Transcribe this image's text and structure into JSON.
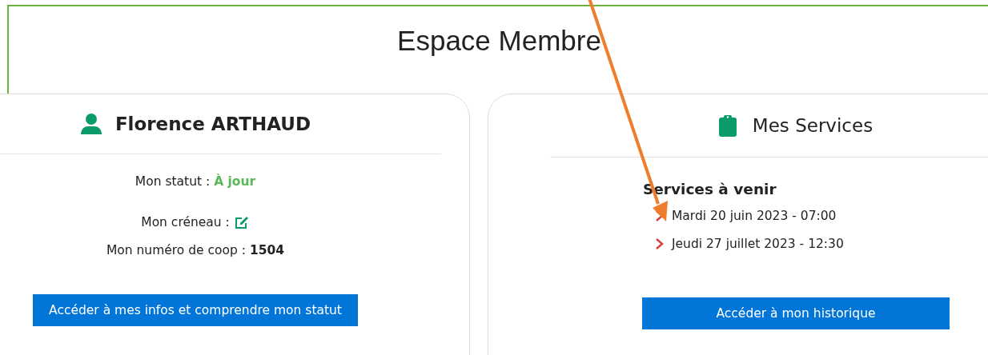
{
  "title": "Espace Membre",
  "member_card": {
    "name": "Florence ARTHAUD",
    "status_label": "Mon statut :",
    "status_value": "À jour",
    "slot_label": "Mon créneau :",
    "coop_label": "Mon numéro de coop :",
    "coop_number": "1504",
    "button": "Accéder à mes infos et comprendre mon statut"
  },
  "services_card": {
    "title": "Mes Services",
    "subtitle": "Services à venir",
    "items": [
      "Mardi 20 juin 2023 - 07:00",
      "Jeudi 27 juillet 2023 - 12:30"
    ],
    "button": "Accéder à mon historique"
  }
}
